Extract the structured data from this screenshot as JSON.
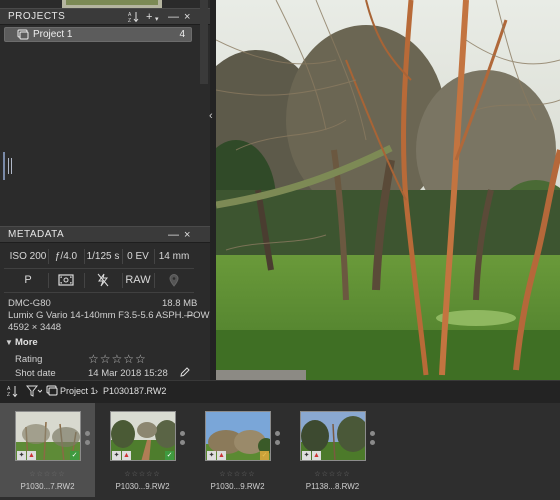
{
  "projects_panel": {
    "title": "PROJECTS",
    "sort_icon": "sort-az-icon",
    "add_label": "+",
    "collapse_label": "—",
    "close_label": "×",
    "items": [
      {
        "label": "Project 1",
        "count": "4",
        "icon": "stack-icon"
      }
    ]
  },
  "metadata_panel": {
    "title": "METADATA",
    "collapse_label": "—",
    "close_label": "×",
    "exposure": [
      "ISO 200",
      "ƒ/4.0",
      "1/125 s",
      "0 EV",
      "14 mm"
    ],
    "modes": [
      {
        "type": "text",
        "label": "P"
      },
      {
        "type": "icon",
        "icon": "metering-icon"
      },
      {
        "type": "icon",
        "icon": "flash-off-icon"
      },
      {
        "type": "text",
        "label": "RAW"
      },
      {
        "type": "icon",
        "icon": "location-icon"
      }
    ],
    "camera": "DMC-G80",
    "file_size": "18.8 MB",
    "lens": "Lumix G Vario 14-140mm F3.5-5.6 ASPH. POWE...",
    "lens_extra": "—",
    "dimensions": "4592 × 3448",
    "more_label": "More",
    "rating_label": "Rating",
    "rating_value": "☆☆☆☆☆",
    "shot_date_label": "Shot date",
    "shot_date_value": "14 Mar 2018 15:28"
  },
  "toolbar": {
    "sort_icon": "sort-az-icon",
    "filter_icon": "filter-icon",
    "project_label": "Project 1",
    "separator": "›",
    "file_label": "P1030187.RW2"
  },
  "thumbnails": [
    {
      "name": "P1030...7.RW2",
      "rating": "☆☆☆☆☆",
      "selected": true,
      "flag_color": "#3f9a3f",
      "flag": "check"
    },
    {
      "name": "P1030...9.RW2",
      "rating": "☆☆☆☆☆",
      "selected": false,
      "flag_color": "#3f9a3f",
      "flag": "check"
    },
    {
      "name": "P1030...9.RW2",
      "rating": "☆☆☆☆☆",
      "selected": false,
      "flag_color": "#caa23a",
      "flag": "check"
    },
    {
      "name": "P1138...8.RW2",
      "rating": "☆☆☆☆☆",
      "selected": false,
      "flag_color": "",
      "flag": ""
    }
  ],
  "colors": {
    "panel_bg": "#2b2b2b",
    "header_bg": "#3a3a3a",
    "selection": "#5c5c5c"
  }
}
